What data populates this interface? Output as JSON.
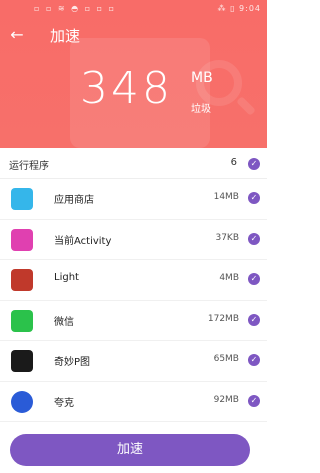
{
  "status_bar": {
    "left": "▫ ▫ ≋ ◓ ▫ ▫ ▫",
    "right": "⁂ ▯ 9:04"
  },
  "header": {
    "back_icon": "back-arrow-icon",
    "title": "加速"
  },
  "summary": {
    "value": "348",
    "unit": "MB",
    "label": "垃圾"
  },
  "section": {
    "title": "运行程序",
    "count": "6"
  },
  "apps": [
    {
      "name": "应用商店",
      "size": "14MB",
      "icon": "app-store-icon",
      "icon_color": "#35b6ea"
    },
    {
      "name": "当前Activity",
      "size": "37KB",
      "icon": "activity-icon",
      "icon_color": "#e040b0"
    },
    {
      "name": "Light",
      "size": "4MB",
      "icon": "flashlight-icon",
      "icon_color": "#c0392b"
    },
    {
      "name": "微信",
      "size": "172MB",
      "icon": "wechat-icon",
      "icon_color": "#2bc24b"
    },
    {
      "name": "奇妙P图",
      "size": "65MB",
      "icon": "photo-editor-icon",
      "icon_color": "#1a1a1a"
    },
    {
      "name": "夸克",
      "size": "92MB",
      "icon": "quark-icon",
      "icon_color": "#2a5bd7"
    }
  ],
  "action_button": {
    "label": "加速"
  },
  "colors": {
    "hero": "#f86c68",
    "accent": "#7e57c2"
  }
}
